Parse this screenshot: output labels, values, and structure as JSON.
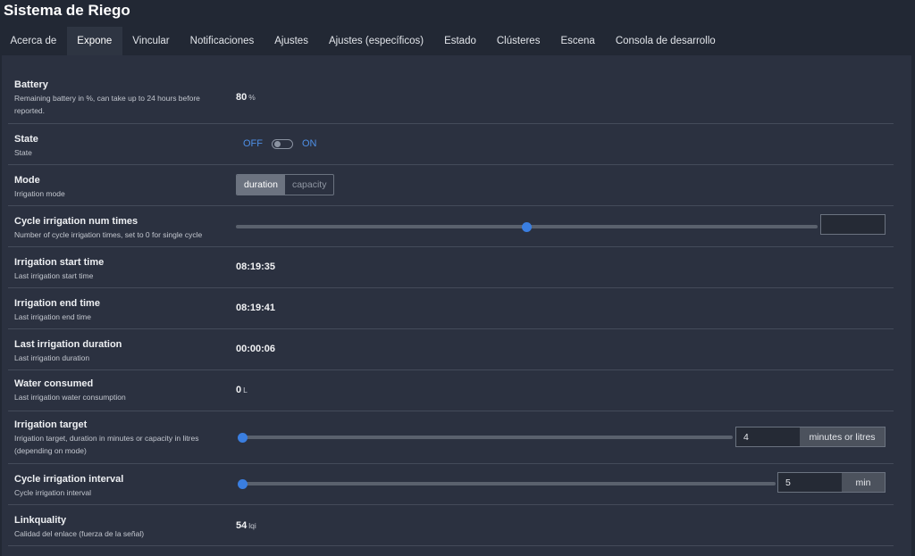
{
  "app": {
    "title": "Sistema de Riego"
  },
  "tabs": [
    {
      "label": "Acerca de"
    },
    {
      "label": "Expone"
    },
    {
      "label": "Vincular"
    },
    {
      "label": "Notificaciones"
    },
    {
      "label": "Ajustes"
    },
    {
      "label": "Ajustes (específicos)"
    },
    {
      "label": "Estado"
    },
    {
      "label": "Clústeres"
    },
    {
      "label": "Escena"
    },
    {
      "label": "Consola de desarrollo"
    }
  ],
  "active_tab": "Expone",
  "rows": {
    "battery": {
      "title": "Battery",
      "desc": "Remaining battery in %, can take up to 24 hours before reported.",
      "value": "80",
      "unit": "%"
    },
    "state": {
      "title": "State",
      "desc": "State",
      "off_label": "OFF",
      "on_label": "ON",
      "is_on": false
    },
    "mode": {
      "title": "Mode",
      "desc": "Irrigation mode",
      "options": [
        "duration",
        "capacity"
      ],
      "selected": "duration"
    },
    "cycle_times": {
      "title": "Cycle irrigation num times",
      "desc": "Number of cycle irrigation times, set to 0 for single cycle",
      "slider_fraction": 0.5,
      "input_value": ""
    },
    "start_time": {
      "title": "Irrigation start time",
      "desc": "Last irrigation start time",
      "value": "08:19:35"
    },
    "end_time": {
      "title": "Irrigation end time",
      "desc": "Last irrigation end time",
      "value": "08:19:41"
    },
    "duration": {
      "title": "Last irrigation duration",
      "desc": "Last irrigation duration",
      "value": "00:00:06"
    },
    "water": {
      "title": "Water consumed",
      "desc": "Last irrigation water consumption",
      "value": "0",
      "unit": "L"
    },
    "target": {
      "title": "Irrigation target",
      "desc": "Irrigation target, duration in minutes or capacity in litres (depending on mode)",
      "slider_fraction": 0.0,
      "input_value": "4",
      "unit": "minutes or litres"
    },
    "interval": {
      "title": "Cycle irrigation interval",
      "desc": "Cycle irrigation interval",
      "slider_fraction": 0.0,
      "input_value": "5",
      "unit": "min"
    },
    "linkquality": {
      "title": "Linkquality",
      "desc": "Calidad del enlace (fuerza de la señal)",
      "value": "54",
      "unit": "lqi"
    }
  }
}
